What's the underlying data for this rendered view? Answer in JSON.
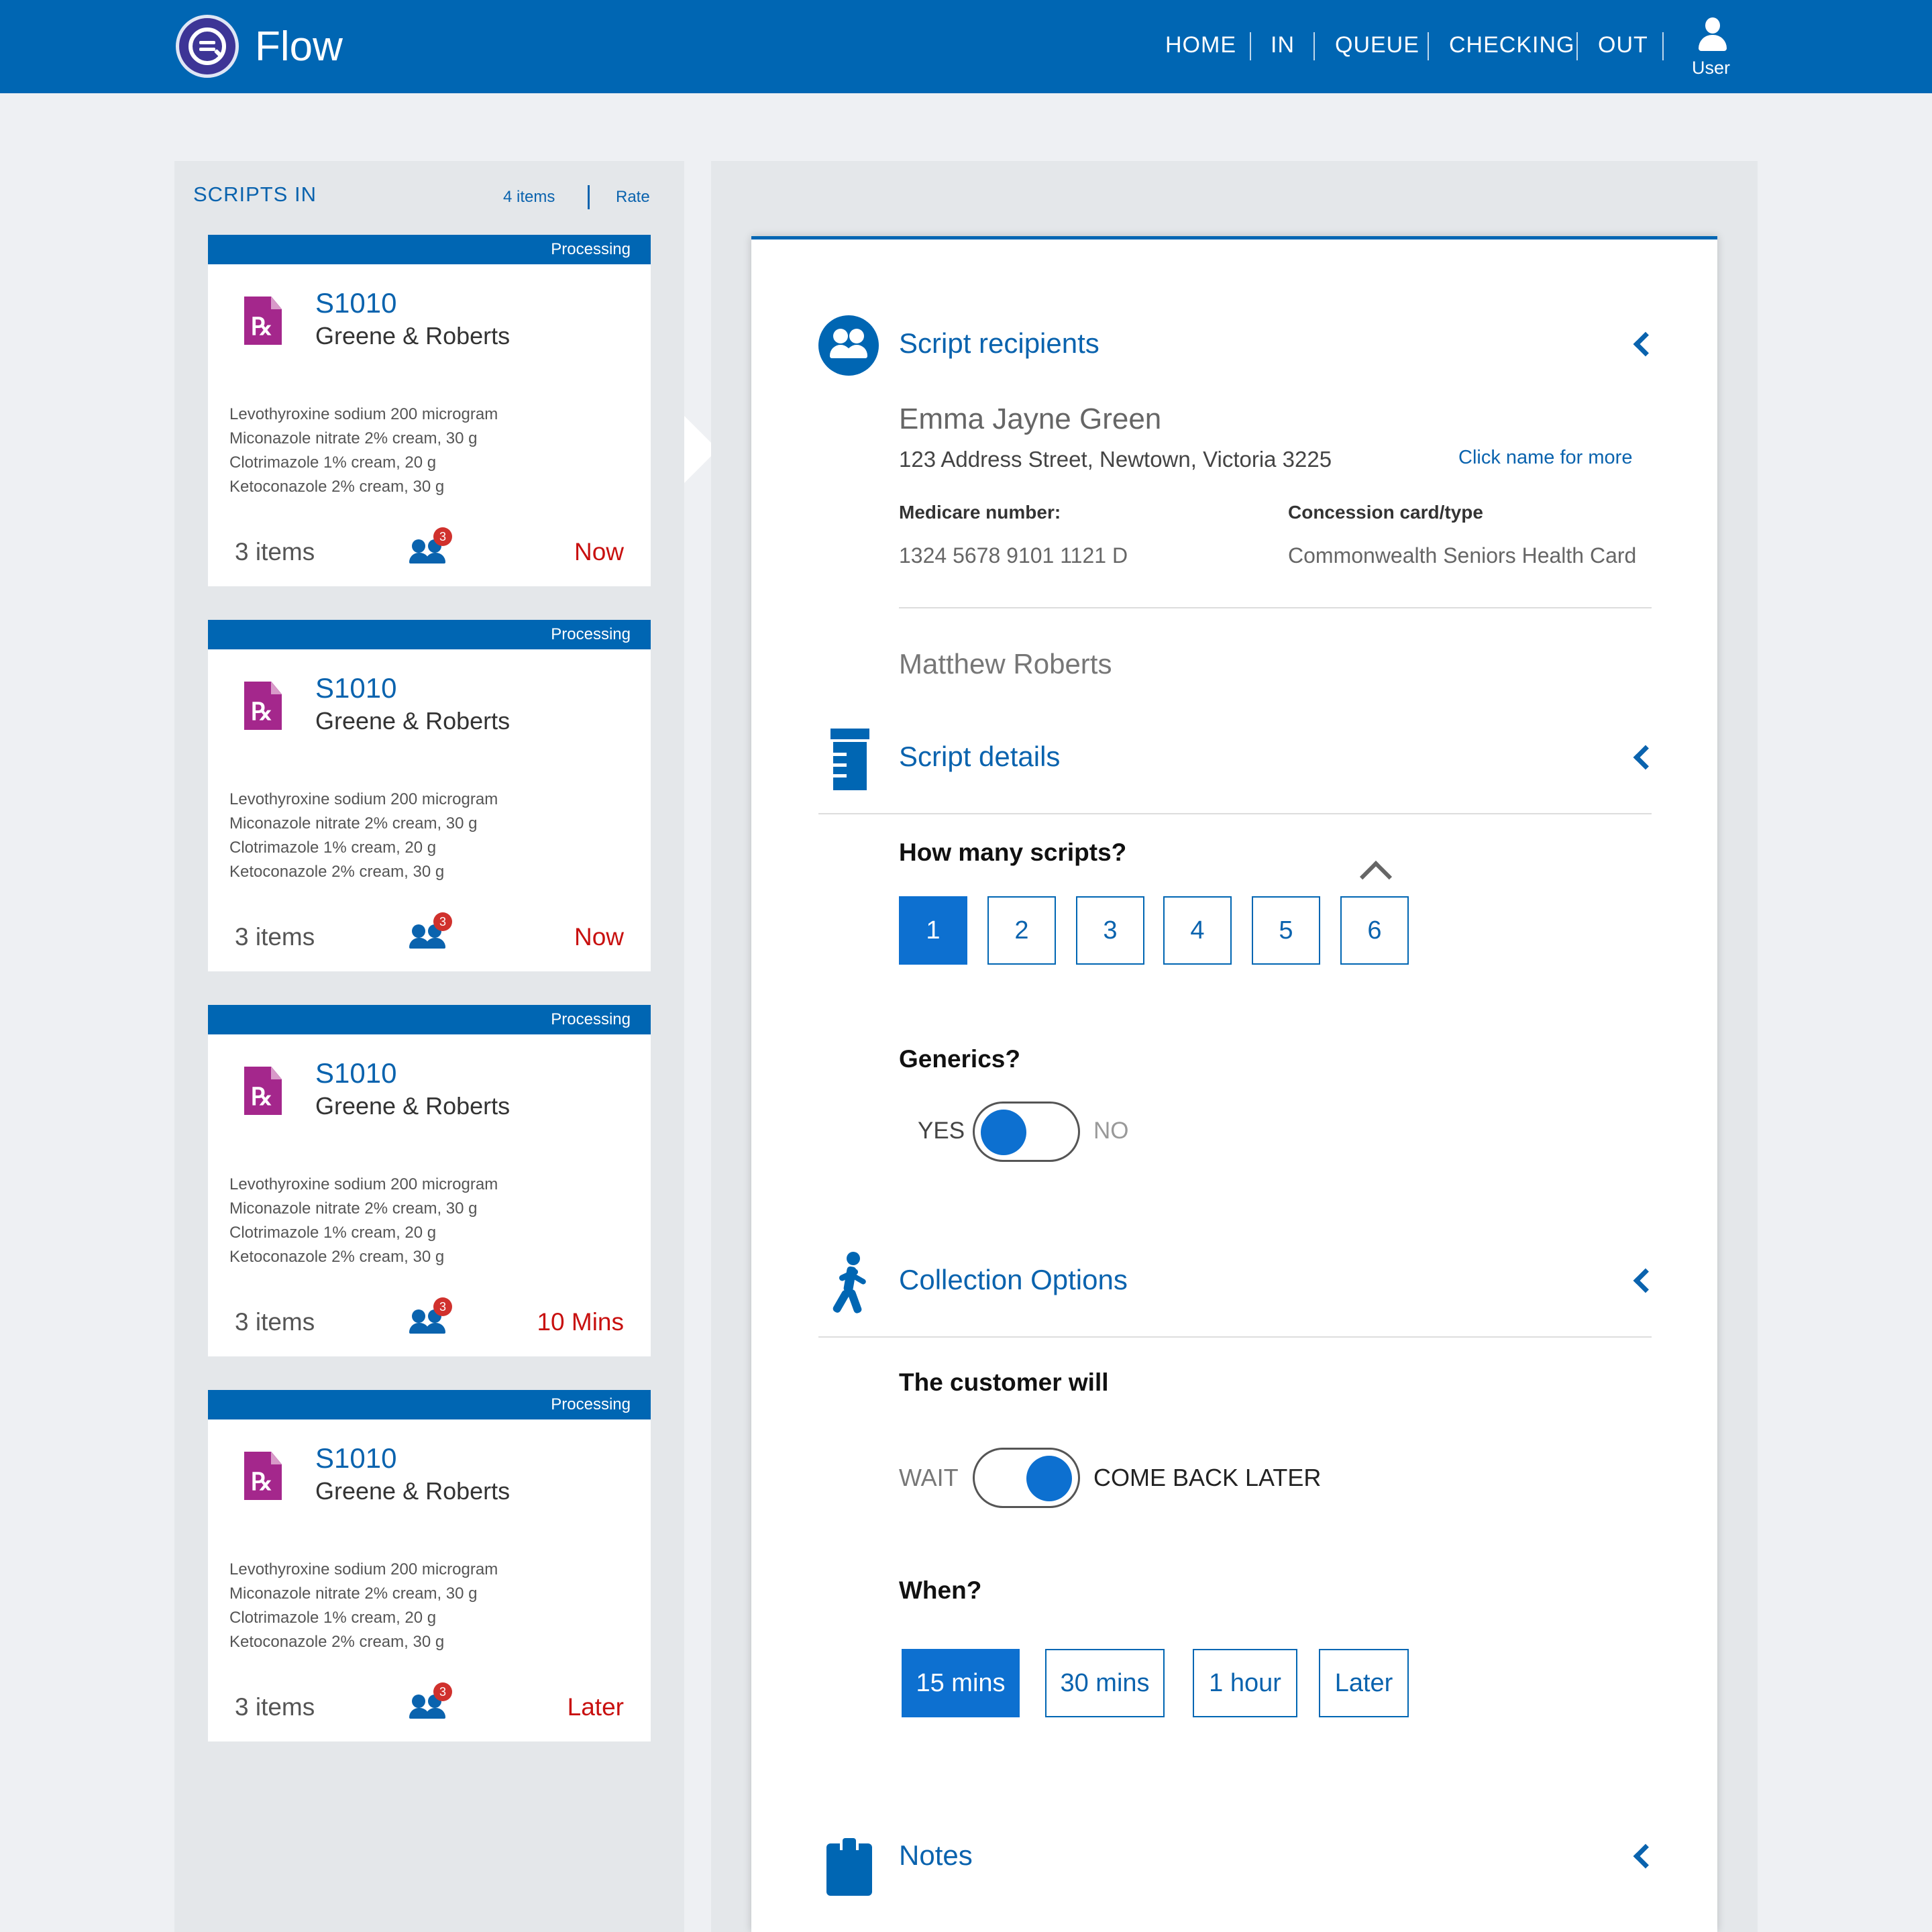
{
  "header": {
    "brand": "Flow",
    "nav": [
      "HOME",
      "IN",
      "QUEUE",
      "CHECKING",
      "OUT"
    ],
    "user_label": "User"
  },
  "scripts_in": {
    "title": "SCRIPTS IN",
    "count": "4 items",
    "rate": "Rate",
    "cards": [
      {
        "status": "Processing",
        "id": "S1010",
        "name": "Greene & Roberts",
        "meds": [
          "Levothyroxine sodium 200 microgram",
          "Miconazole nitrate 2% cream, 30 g",
          "Clotrimazole 1% cream, 20 g",
          "Ketoconazole 2% cream, 30 g"
        ],
        "items": "3 items",
        "badge": "3",
        "when": "Now"
      },
      {
        "status": "Processing",
        "id": "S1010",
        "name": "Greene & Roberts",
        "meds": [
          "Levothyroxine sodium 200 microgram",
          "Miconazole nitrate 2% cream, 30 g",
          "Clotrimazole 1% cream, 20 g",
          "Ketoconazole 2% cream, 30 g"
        ],
        "items": "3 items",
        "badge": "3",
        "when": "Now"
      },
      {
        "status": "Processing",
        "id": "S1010",
        "name": "Greene & Roberts",
        "meds": [
          "Levothyroxine sodium 200 microgram",
          "Miconazole nitrate 2% cream, 30 g",
          "Clotrimazole 1% cream, 20 g",
          "Ketoconazole 2% cream, 30 g"
        ],
        "items": "3 items",
        "badge": "3",
        "when": "10 Mins"
      },
      {
        "status": "Processing",
        "id": "S1010",
        "name": "Greene & Roberts",
        "meds": [
          "Levothyroxine sodium 200 microgram",
          "Miconazole nitrate 2% cream, 30 g",
          "Clotrimazole 1% cream, 20 g",
          "Ketoconazole 2% cream, 30 g"
        ],
        "items": "3 items",
        "badge": "3",
        "when": "Later"
      }
    ]
  },
  "recipients": {
    "title": "Script recipients",
    "primary_name": "Emma Jayne Green",
    "address": "123 Address Street, Newtown, Victoria 3225",
    "more_link": "Click name for more",
    "medicare_label": "Medicare number:",
    "medicare_value": "1324 5678 9101 1121 D",
    "concession_label": "Concession card/type",
    "concession_value": "Commonwealth Seniors Health Card",
    "secondary_name": "Matthew Roberts"
  },
  "details": {
    "title": "Script details",
    "how_many_label": "How many scripts?",
    "counts": [
      "1",
      "2",
      "3",
      "4",
      "5",
      "6"
    ],
    "selected_count": "1",
    "generics_label": "Generics?",
    "generics_yes": "YES",
    "generics_no": "NO",
    "generics_value": "YES"
  },
  "collection": {
    "title": "Collection Options",
    "customer_label": "The customer will",
    "wait": "WAIT",
    "later": "COME BACK LATER",
    "selected": "COME BACK LATER",
    "when_label": "When?",
    "times": [
      "15 mins",
      "30 mins",
      "1 hour",
      "Later"
    ],
    "selected_time": "15 mins"
  },
  "notes": {
    "title": "Notes"
  },
  "colors": {
    "primary": "#0066b3",
    "accent": "#0d70d0",
    "alert": "#c8100f",
    "rx": "#a4278c"
  }
}
